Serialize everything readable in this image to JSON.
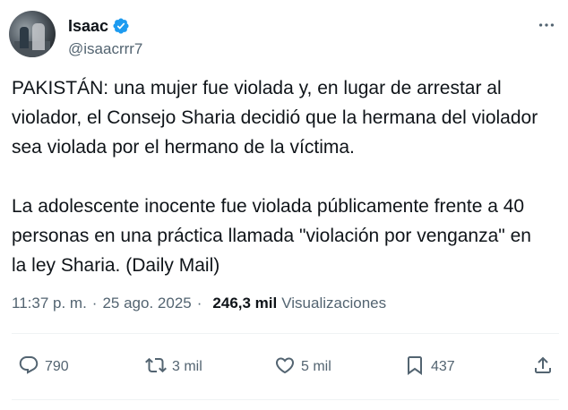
{
  "author": {
    "display_name": "Isaac",
    "handle": "@isaacrrr7",
    "verified_color": "#1d9bf0"
  },
  "tweet": {
    "paragraph1": "PAKISTÁN: una mujer fue violada y, en lugar de arrestar al violador, el Consejo Sharia decidió que la hermana del violador sea violada por el hermano de la víctima.",
    "paragraph2": "La adolescente inocente fue violada públicamente frente a 40 personas en una práctica llamada \"violación por venganza\" en la ley Sharia. (Daily Mail)"
  },
  "meta": {
    "time": "11:37 p. m.",
    "separator": "·",
    "date": "25 ago. 2025",
    "views_count": "246,3 mil",
    "views_label": "Visualizaciones"
  },
  "actions": {
    "replies": "790",
    "reposts": "3 mil",
    "likes": "5 mil",
    "bookmarks": "437"
  },
  "icons": {
    "verified": "verified-badge-icon",
    "more": "more-options-icon",
    "reply": "reply-icon",
    "repost": "repost-icon",
    "like": "heart-icon",
    "bookmark": "bookmark-icon",
    "share": "share-icon"
  },
  "colors": {
    "text": "#0f1419",
    "secondary": "#536471",
    "accent": "#1d9bf0"
  }
}
